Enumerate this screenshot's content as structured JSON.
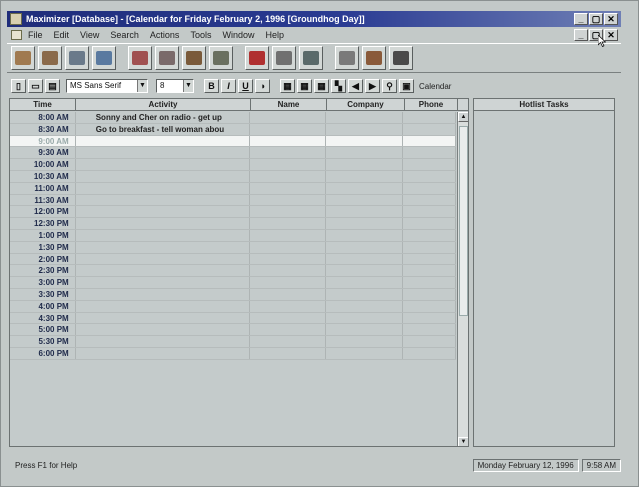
{
  "window": {
    "title": "Maximizer [Database] - [Calendar for Friday  February  2, 1996 [Groundhog Day]]"
  },
  "window_buttons": [
    "_",
    "▢",
    "✕"
  ],
  "menu": [
    "File",
    "Edit",
    "View",
    "Search",
    "Actions",
    "Tools",
    "Window",
    "Help"
  ],
  "toolbar_icons": [
    {
      "name": "address-book-icon",
      "color": "#a07a50"
    },
    {
      "name": "people-icon",
      "color": "#8a6a4a"
    },
    {
      "name": "org-chart-icon",
      "color": "#6a7a8a"
    },
    {
      "name": "notes-icon",
      "color": "#5a7aa0"
    },
    {
      "name": "calendar-icon",
      "color": "#a05050"
    },
    {
      "name": "graph-icon",
      "color": "#7a6a6a"
    },
    {
      "name": "tasks-icon",
      "color": "#7a5a3a"
    },
    {
      "name": "contacts-card-icon",
      "color": "#6a7060"
    },
    {
      "name": "phone-icon",
      "color": "#b03030"
    },
    {
      "name": "dialer-icon",
      "color": "#707070"
    },
    {
      "name": "monitor-icon",
      "color": "#5a6a6a"
    },
    {
      "name": "printer-icon",
      "color": "#7a7a7a"
    },
    {
      "name": "binder-icon",
      "color": "#8a5a3a"
    },
    {
      "name": "ship-icon",
      "color": "#4a4a4a"
    }
  ],
  "format_toolbar": {
    "font": "MS Sans Serif",
    "size": "8",
    "bold": "B",
    "italic": "I",
    "underline": "U",
    "label": "Calendar"
  },
  "columns": [
    "Time",
    "Activity",
    "Name",
    "Company",
    "Phone"
  ],
  "rows": [
    {
      "time": "8:00 AM",
      "activity": "Sonny and Cher on radio - get up"
    },
    {
      "time": "8:30 AM",
      "activity": "Go to breakfast - tell woman abou"
    },
    {
      "time": "9:00 AM",
      "activity": "",
      "selected": true
    },
    {
      "time": "9:30 AM",
      "activity": ""
    },
    {
      "time": "10:00 AM",
      "activity": ""
    },
    {
      "time": "10:30 AM",
      "activity": ""
    },
    {
      "time": "11:00 AM",
      "activity": ""
    },
    {
      "time": "11:30 AM",
      "activity": ""
    },
    {
      "time": "12:00 PM",
      "activity": ""
    },
    {
      "time": "12:30 PM",
      "activity": ""
    },
    {
      "time": "1:00 PM",
      "activity": ""
    },
    {
      "time": "1:30 PM",
      "activity": ""
    },
    {
      "time": "2:00 PM",
      "activity": ""
    },
    {
      "time": "2:30 PM",
      "activity": ""
    },
    {
      "time": "3:00 PM",
      "activity": ""
    },
    {
      "time": "3:30 PM",
      "activity": ""
    },
    {
      "time": "4:00 PM",
      "activity": ""
    },
    {
      "time": "4:30 PM",
      "activity": ""
    },
    {
      "time": "5:00 PM",
      "activity": ""
    },
    {
      "time": "5:30 PM",
      "activity": ""
    },
    {
      "time": "6:00 PM",
      "activity": ""
    }
  ],
  "hotlist": {
    "header": "Hotlist Tasks"
  },
  "status": {
    "help": "Press F1 for Help",
    "date": "Monday  February 12, 1996",
    "time": "9:58 AM"
  }
}
